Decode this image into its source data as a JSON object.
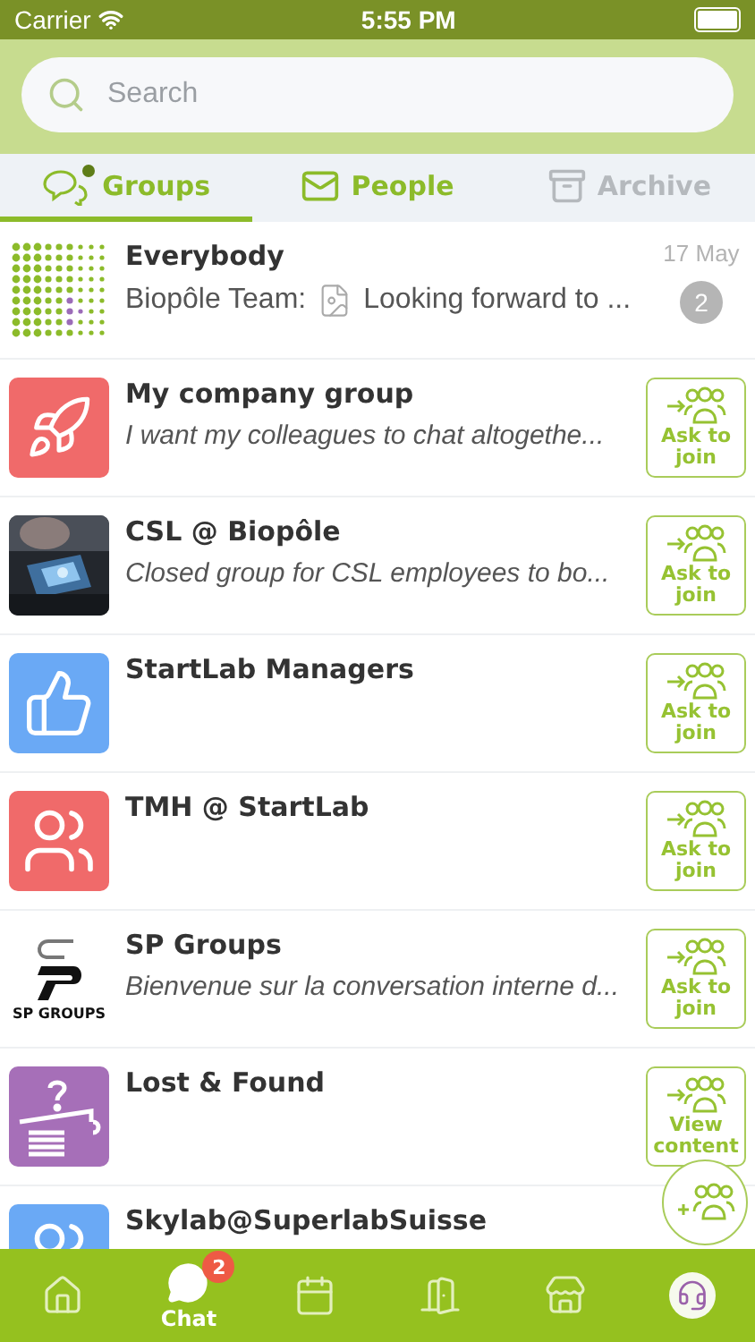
{
  "status_bar": {
    "carrier": "Carrier",
    "time": "5:55 PM"
  },
  "search": {
    "placeholder": "Search"
  },
  "tabs": [
    {
      "label": "Groups",
      "kind": "groups",
      "selected": true,
      "unread": true
    },
    {
      "label": "People",
      "kind": "people",
      "selected": false
    },
    {
      "label": "Archive",
      "kind": "archive",
      "selected": false
    }
  ],
  "rows": [
    {
      "kind": "conversation",
      "avatar": {
        "kind": "dots"
      },
      "title": "Everybody",
      "sender": "Biopôle Team:",
      "preview": "Looking forward to ...",
      "date": "17 May",
      "unread": "2"
    },
    {
      "kind": "group",
      "avatar": {
        "kind": "rocket",
        "color": "#f06a6a"
      },
      "title": "My company group",
      "subtitle": "I want my colleagues to chat altogethe...",
      "action": "Ask to join"
    },
    {
      "kind": "group",
      "title": "CSL @ Biopôle",
      "subtitle": "Closed group for CSL employees to bo...",
      "action": "Ask to join"
    },
    {
      "kind": "group",
      "avatar": {
        "kind": "thumb",
        "color": "#6aa9f5"
      },
      "title": "StartLab Managers",
      "action": "Ask to join"
    },
    {
      "kind": "group",
      "avatar": {
        "kind": "people",
        "color": "#f06a6a"
      },
      "title": "TMH @ StartLab",
      "action": "Ask to join"
    },
    {
      "kind": "group",
      "avatar": {
        "kind": "logo",
        "text": "SP GROUPS"
      },
      "title": "SP Groups",
      "subtitle": "Bienvenue sur la conversation interne d...",
      "action": "Ask to join"
    },
    {
      "kind": "group",
      "avatar": {
        "kind": "lost",
        "color": "#a66fb8"
      },
      "title": "Lost & Found",
      "action": "View content"
    },
    {
      "kind": "group",
      "avatar": {
        "kind": "people",
        "color": "#6aa9f5"
      },
      "title": "Skylab@SuperlabSuisse"
    }
  ],
  "nav": [
    {
      "kind": "home",
      "selected": false
    },
    {
      "kind": "chat",
      "label": "Chat",
      "badge": "2",
      "selected": true
    },
    {
      "kind": "calendar",
      "selected": false
    },
    {
      "kind": "door",
      "selected": false
    },
    {
      "kind": "store",
      "selected": false
    },
    {
      "kind": "support",
      "selected": false
    }
  ]
}
